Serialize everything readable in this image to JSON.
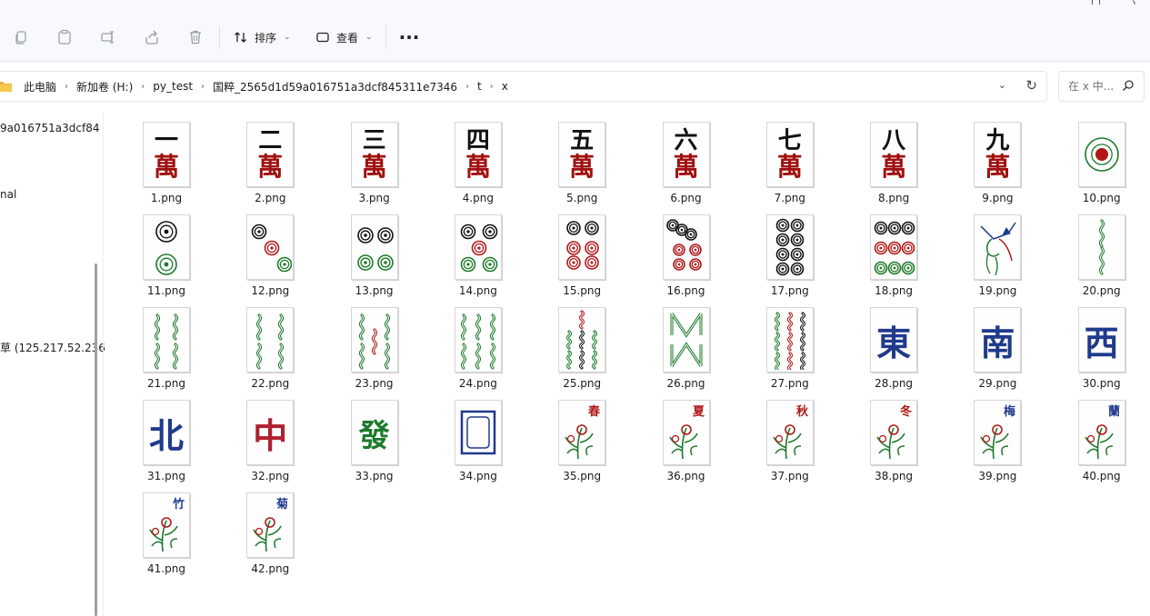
{
  "toolbar": {
    "sort_label": "排序",
    "view_label": "查看",
    "more_label": "···",
    "icons": [
      "copy-icon",
      "paste-icon",
      "rename-icon",
      "share-icon",
      "delete-icon"
    ]
  },
  "address": {
    "crumbs": [
      "此电脑",
      "新加卷 (H:)",
      "py_test",
      "国粹_2565d1d59a016751a3dcf845311e7346",
      "t",
      "x"
    ]
  },
  "search": {
    "placeholder": "在 x 中..."
  },
  "nav": {
    "items": [
      "9a016751a3dcf84",
      "nal",
      "草 (125.217.52.236"
    ]
  },
  "colors": {
    "wan": "#a01010",
    "bamboo": "#1d7a2a",
    "circle_red": "#b01818",
    "circle_black": "#111111",
    "wind": "#203a8c"
  },
  "files": [
    {
      "label": "1.png",
      "kind": "wan",
      "char": "一"
    },
    {
      "label": "2.png",
      "kind": "wan",
      "char": "二"
    },
    {
      "label": "3.png",
      "kind": "wan",
      "char": "三"
    },
    {
      "label": "4.png",
      "kind": "wan",
      "char": "四"
    },
    {
      "label": "5.png",
      "kind": "wan",
      "char": "五"
    },
    {
      "label": "6.png",
      "kind": "wan",
      "char": "六"
    },
    {
      "label": "7.png",
      "kind": "wan",
      "char": "七"
    },
    {
      "label": "8.png",
      "kind": "wan",
      "char": "八"
    },
    {
      "label": "9.png",
      "kind": "wan",
      "char": "九"
    },
    {
      "label": "10.png",
      "kind": "circle-big"
    },
    {
      "label": "11.png",
      "kind": "circles",
      "n": 2
    },
    {
      "label": "12.png",
      "kind": "circles",
      "n": 3
    },
    {
      "label": "13.png",
      "kind": "circles",
      "n": 4
    },
    {
      "label": "14.png",
      "kind": "circles",
      "n": 5
    },
    {
      "label": "15.png",
      "kind": "circles",
      "n": 6
    },
    {
      "label": "16.png",
      "kind": "circles",
      "n": 7
    },
    {
      "label": "17.png",
      "kind": "circles",
      "n": 8
    },
    {
      "label": "18.png",
      "kind": "circles",
      "n": 9
    },
    {
      "label": "19.png",
      "kind": "bird"
    },
    {
      "label": "20.png",
      "kind": "bamboo",
      "n": 2
    },
    {
      "label": "21.png",
      "kind": "bamboo",
      "n": 4
    },
    {
      "label": "22.png",
      "kind": "bamboo",
      "n": 6
    },
    {
      "label": "23.png",
      "kind": "bamboo",
      "n": 5
    },
    {
      "label": "24.png",
      "kind": "bamboo",
      "n": 6
    },
    {
      "label": "25.png",
      "kind": "bamboo",
      "n": 7
    },
    {
      "label": "26.png",
      "kind": "bamboo",
      "n": 8
    },
    {
      "label": "27.png",
      "kind": "bamboo",
      "n": 9
    },
    {
      "label": "28.png",
      "kind": "wind",
      "char": "東"
    },
    {
      "label": "29.png",
      "kind": "wind",
      "char": "南"
    },
    {
      "label": "30.png",
      "kind": "wind",
      "char": "西"
    },
    {
      "label": "31.png",
      "kind": "wind",
      "char": "北"
    },
    {
      "label": "32.png",
      "kind": "red-dragon",
      "char": "中"
    },
    {
      "label": "33.png",
      "kind": "green-dragon",
      "char": "發"
    },
    {
      "label": "34.png",
      "kind": "white-dragon"
    },
    {
      "label": "35.png",
      "kind": "flower",
      "char": "春",
      "color": "#b01818"
    },
    {
      "label": "36.png",
      "kind": "flower",
      "char": "夏",
      "color": "#b01818"
    },
    {
      "label": "37.png",
      "kind": "flower",
      "char": "秋",
      "color": "#b01818"
    },
    {
      "label": "38.png",
      "kind": "flower",
      "char": "冬",
      "color": "#b01818"
    },
    {
      "label": "39.png",
      "kind": "flower",
      "char": "梅",
      "color": "#203a8c"
    },
    {
      "label": "40.png",
      "kind": "flower",
      "char": "蘭",
      "color": "#203a8c"
    },
    {
      "label": "41.png",
      "kind": "flower",
      "char": "竹",
      "color": "#203a8c"
    },
    {
      "label": "42.png",
      "kind": "flower",
      "char": "菊",
      "color": "#203a8c"
    }
  ]
}
